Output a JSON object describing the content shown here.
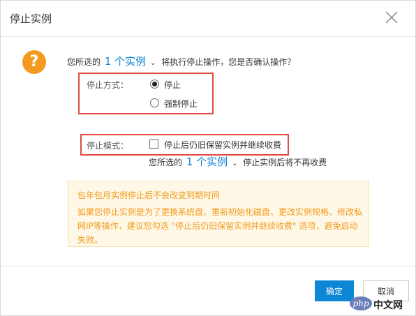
{
  "dialog": {
    "title": "停止实例",
    "close_icon": "close-icon"
  },
  "confirm": {
    "prefix": "您所选的",
    "count": "1 个实例",
    "suffix": "将执行停止操作，您是否确认操作？"
  },
  "stop_method": {
    "label": "停止方式：",
    "options": [
      "停止",
      "强制停止"
    ],
    "selected": "停止"
  },
  "stop_mode": {
    "label": "停止模式：",
    "checkbox_label": "停止后仍旧保留实例并继续收费",
    "checked": false
  },
  "billing_note": {
    "prefix": "您所选的",
    "count": "1 个实例",
    "suffix": "停止实例后将不再收费"
  },
  "notice": {
    "title": "包年包月实例停止后不会改变到期时间",
    "body": "如果您停止实例是为了更换系统盘、重新初始化磁盘、更改实例规格、修改私网IP等操作，建议您勾选 \"停止后仍旧保留实例并继续收费\" 选项，避免启动失败。"
  },
  "footer": {
    "ok_label": "确定",
    "cancel_label": "取消"
  },
  "watermark": {
    "badge": "php",
    "text": "中文网"
  },
  "colors": {
    "accent": "#0e86d6",
    "warning": "#f49a1e",
    "highlight_border": "#e24b3d"
  }
}
